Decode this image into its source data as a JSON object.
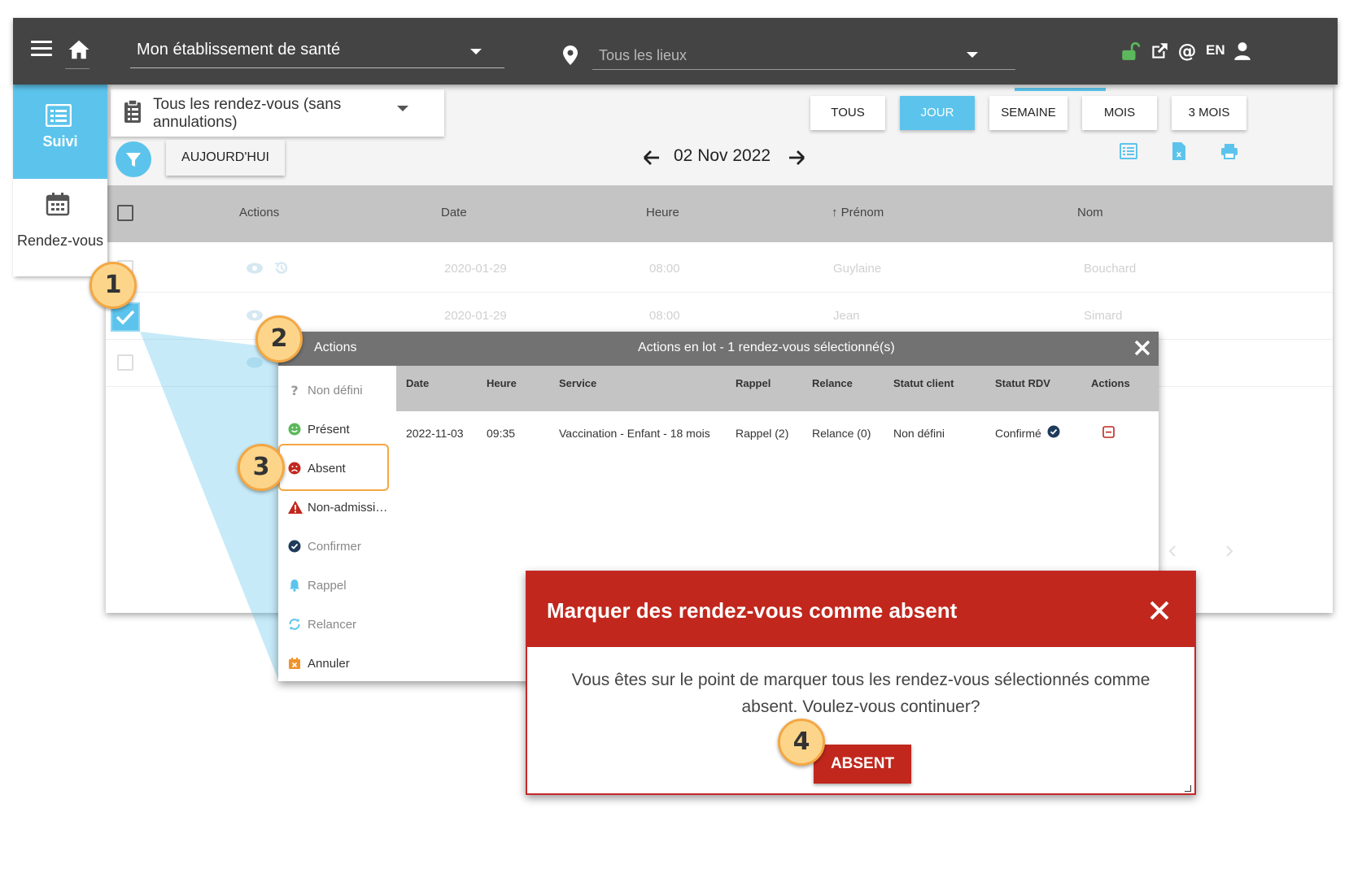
{
  "topbar": {
    "establishment": "Mon établissement de santé",
    "location_placeholder": "Tous les lieux",
    "language": "EN"
  },
  "sidebar": {
    "items": [
      {
        "label": "Suivi",
        "icon": "list-icon",
        "active": true
      },
      {
        "label": "Rendez-vous",
        "icon": "calendar-icon",
        "active": false
      }
    ]
  },
  "toolbar": {
    "filter_select": "Tous les rendez-vous (sans annulations)",
    "views": [
      "TOUS",
      "JOUR",
      "SEMAINE",
      "MOIS",
      "3 MOIS"
    ],
    "active_view": "JOUR",
    "today_label": "AUJOURD'HUI",
    "current_date": "02 Nov 2022",
    "accent_color": "#5cc4ec"
  },
  "table": {
    "headers": [
      "Actions",
      "Date",
      "Heure",
      "Prénom",
      "Nom"
    ],
    "sort_indicator": "↑",
    "rows": [
      {
        "date": "2020-01-29",
        "heure": "08:00",
        "prenom": "Guylaine",
        "nom": "Bouchard",
        "checked": false
      },
      {
        "date": "2020-01-29",
        "heure": "08:00",
        "prenom": "Jean",
        "nom": "Simard",
        "checked": true
      }
    ]
  },
  "batch": {
    "actions_title": "Actions",
    "title": "Actions en lot - 1 rendez-vous sélectionné(s)",
    "actions": [
      {
        "label": "Non défini",
        "icon": "question-icon"
      },
      {
        "label": "Présent",
        "icon": "smile-icon"
      },
      {
        "label": "Absent",
        "icon": "frown-icon"
      },
      {
        "label": "Non-admissi…",
        "icon": "warning-icon"
      },
      {
        "label": "Confirmer",
        "icon": "check-circle-icon"
      },
      {
        "label": "Rappel",
        "icon": "bell-icon"
      },
      {
        "label": "Relancer",
        "icon": "refresh-icon"
      },
      {
        "label": "Annuler",
        "icon": "calendar-x-icon"
      }
    ],
    "columns": [
      "Date",
      "Heure",
      "Service",
      "Rappel",
      "Relance",
      "Statut client",
      "Statut RDV",
      "Actions"
    ],
    "row": {
      "date": "2022-11-03",
      "heure": "09:35",
      "service": "Vaccination - Enfant - 18 mois",
      "rappel": "Rappel (2)",
      "relance": "Relance (0)",
      "statut_client": "Non défini",
      "statut_rdv": "Confirmé"
    }
  },
  "confirm": {
    "title": "Marquer des rendez-vous comme absent",
    "message": "Vous êtes sur le point de marquer tous les rendez-vous sélectionnés comme absent. Voulez-vous continuer?",
    "button": "ABSENT",
    "color": "#c1271d"
  },
  "steps": [
    "1",
    "2",
    "3",
    "4"
  ]
}
